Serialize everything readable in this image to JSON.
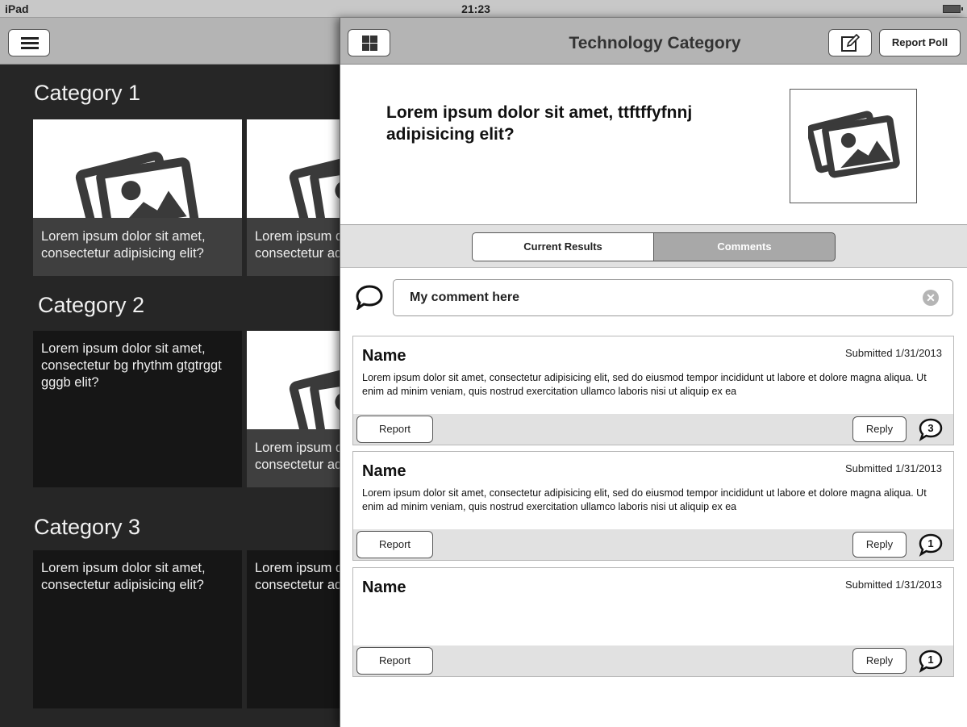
{
  "status_bar": {
    "carrier": "iPad",
    "time": "21:23"
  },
  "left_pane": {
    "categories": [
      {
        "title": "Category 1",
        "tiles": [
          {
            "caption": "Lorem ipsum dolor sit amet, consectetur adipisicing elit?"
          },
          {
            "caption": "Lorem ipsum dolor sit amet, consectetur adipisicing elit?"
          }
        ]
      },
      {
        "title": "Category 2",
        "tiles": [
          {
            "caption": "Lorem ipsum dolor sit amet, consectetur bg rhythm gtgtrggt gggb elit?"
          },
          {
            "caption": "Lorem ipsum dolor sit amet, consectetur adipisicing elit?"
          }
        ]
      },
      {
        "title": "Category 3",
        "tiles": [
          {
            "caption": "Lorem ipsum dolor sit amet, consectetur adipisicing elit?"
          },
          {
            "caption": "Lorem ipsum dolor sit amet, consectetur adipisicing elit?"
          }
        ]
      }
    ]
  },
  "panel": {
    "title": "Technology Category",
    "report_poll_label": "Report Poll",
    "question": "Lorem ipsum dolor sit amet, ttftffyfnnj adipisicing elit?",
    "tabs": {
      "current_results": "Current Results",
      "comments": "Comments"
    },
    "comment_input_value": "My comment here",
    "comments": [
      {
        "name": "Name",
        "date": "Submitted 1/31/2013",
        "body": "Lorem ipsum dolor sit amet, consectetur adipisicing elit, sed do eiusmod tempor incididunt ut labore et dolore magna aliqua. Ut enim ad minim veniam, quis nostrud exercitation ullamco laboris nisi ut aliquip ex ea",
        "report_label": "Report",
        "reply_label": "Reply",
        "reply_count": "3"
      },
      {
        "name": "Name",
        "date": "Submitted 1/31/2013",
        "body": "Lorem ipsum dolor sit amet, consectetur adipisicing elit, sed do eiusmod tempor incididunt ut labore et dolore magna aliqua. Ut enim ad minim veniam, quis nostrud exercitation ullamco laboris nisi ut aliquip ex ea",
        "report_label": "Report",
        "reply_label": "Reply",
        "reply_count": "1"
      },
      {
        "name": "Name",
        "date": "Submitted 1/31/2013",
        "body": "",
        "report_label": "Report",
        "reply_label": "Reply",
        "reply_count": "1"
      }
    ]
  },
  "icons": [
    "menu-icon",
    "grid-icon",
    "edit-icon",
    "photo-icon",
    "speech-bubble-icon",
    "clear-icon"
  ]
}
